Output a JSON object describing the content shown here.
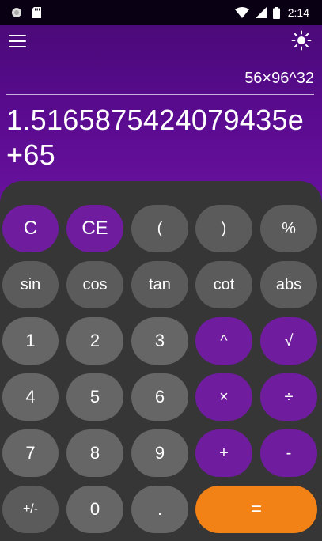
{
  "status_bar": {
    "time": "2:14"
  },
  "display": {
    "expression": "56×96^32",
    "result": "1.5165875424079435e+65"
  },
  "keys": {
    "clear": "C",
    "clear_entry": "CE",
    "open_paren": "(",
    "close_paren": ")",
    "percent": "%",
    "sin": "sin",
    "cos": "cos",
    "tan": "tan",
    "cot": "cot",
    "abs": "abs",
    "one": "1",
    "two": "2",
    "three": "3",
    "power": "^",
    "sqrt": "√",
    "four": "4",
    "five": "5",
    "six": "6",
    "multiply": "×",
    "divide": "÷",
    "seven": "7",
    "eight": "8",
    "nine": "9",
    "plus": "+",
    "minus": "-",
    "negate": "+/-",
    "zero": "0",
    "decimal": ".",
    "equals": "="
  },
  "icons": [
    "notification-circle-icon",
    "sd-card-icon",
    "wifi-icon",
    "cellular-signal-icon",
    "battery-icon",
    "menu-icon",
    "theme-toggle-icon"
  ],
  "colors": {
    "accent_purple": "#6f1d9e",
    "header_purple": "#5a0b8f",
    "equals_orange": "#f38216",
    "key_gray": "#666666",
    "func_gray": "#5b5b5b",
    "keypad_bg": "#363636"
  }
}
